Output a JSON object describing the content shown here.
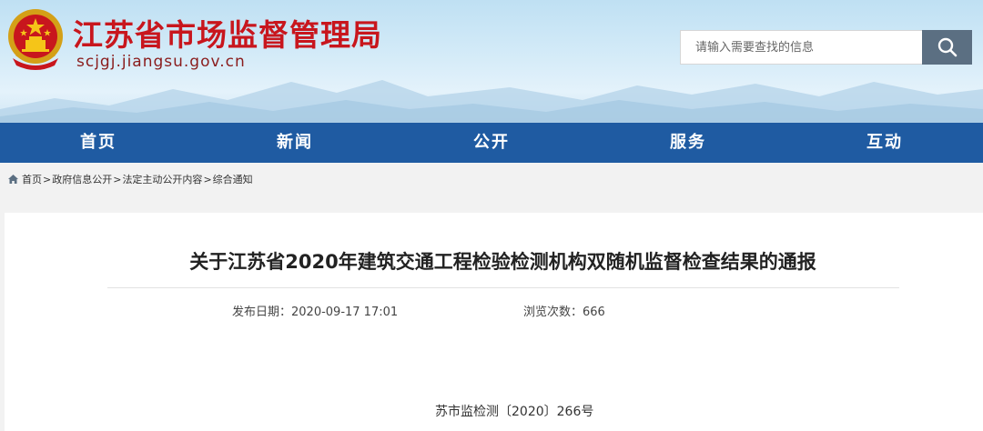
{
  "header": {
    "site_title": "江苏省市场监督管理局",
    "site_domain": "scjgj.jiangsu.gov.cn",
    "emblem_icon": "national-emblem-icon",
    "search": {
      "placeholder": "请输入需要查找的信息",
      "button_icon": "search-icon"
    }
  },
  "nav": {
    "items": [
      {
        "label": "首页"
      },
      {
        "label": "新闻"
      },
      {
        "label": "公开"
      },
      {
        "label": "服务"
      },
      {
        "label": "互动"
      }
    ]
  },
  "breadcrumb": {
    "icon": "home-icon",
    "items": [
      "首页",
      "政府信息公开",
      "法定主动公开内容",
      "综合通知"
    ],
    "separator": ">"
  },
  "article": {
    "title": "关于江苏省2020年建筑交通工程检验检测机构双随机监督检查结果的通报",
    "publish_date": "发布日期：2020-09-17 17:01",
    "view_count": "浏览次数：666",
    "doc_number": "苏市监检测〔2020〕266号"
  },
  "colors": {
    "title_red": "#c8161d",
    "nav_blue": "#1f5ba2",
    "search_button": "#5b6f82",
    "page_bg": "#f2f2f2"
  }
}
